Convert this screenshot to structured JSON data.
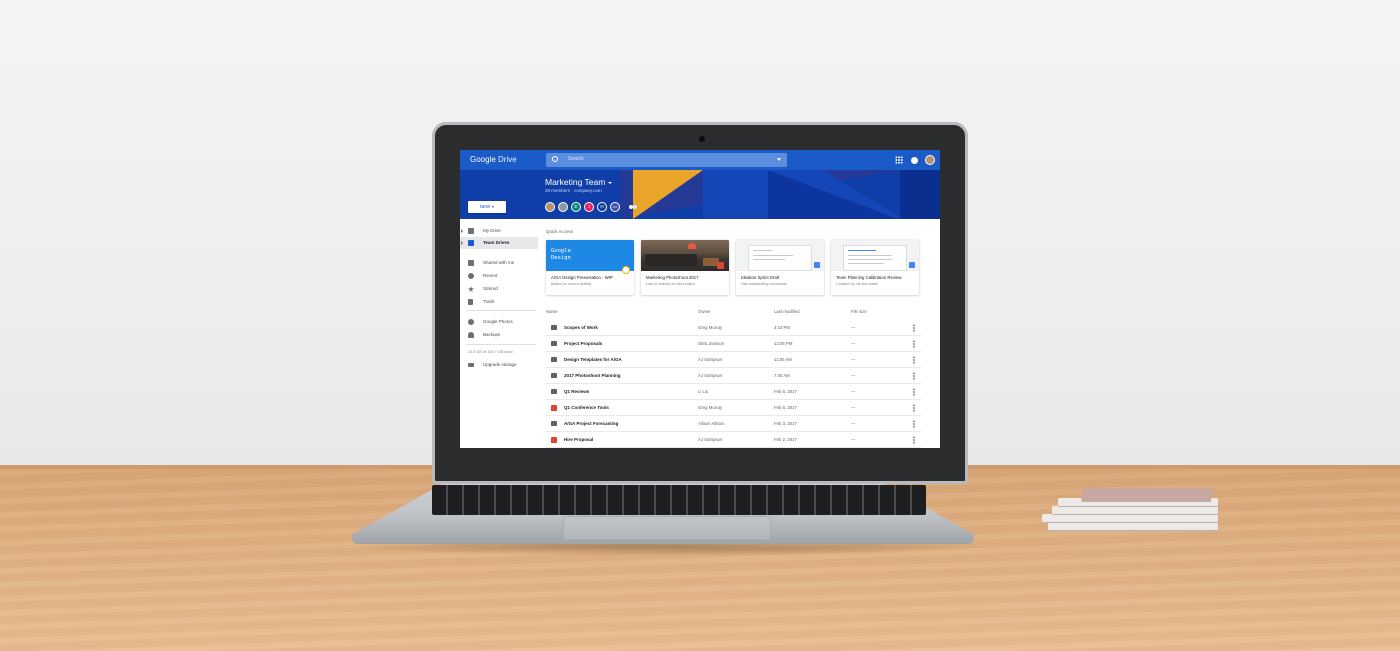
{
  "app": {
    "logo_prefix": "Google",
    "logo_name": "Drive"
  },
  "search": {
    "placeholder": "Search"
  },
  "team": {
    "title": "Marketing Team",
    "subtitle": "29 members · company.com"
  },
  "members": [
    {
      "initial": "",
      "color": "#b88e6b"
    },
    {
      "initial": "",
      "color": "#8a9aa6"
    },
    {
      "initial": "E",
      "color": "#00897b"
    },
    {
      "initial": "J",
      "color": "#e91e63"
    },
    {
      "initial": "H",
      "color": "#0f3ea8"
    },
    {
      "initial": "•••",
      "color": "#3f51b5"
    }
  ],
  "new_button": {
    "label": "NEW"
  },
  "sidebar": {
    "items": [
      {
        "label": "My Drive",
        "icon": "drive-icon"
      },
      {
        "label": "Team Drives",
        "icon": "team-drives-icon",
        "active": true
      },
      {
        "label": "Shared with me",
        "icon": "people-icon"
      },
      {
        "label": "Recent",
        "icon": "clock-icon"
      },
      {
        "label": "Starred",
        "icon": "star-icon"
      },
      {
        "label": "Trash",
        "icon": "trash-icon"
      },
      {
        "label": "Google Photos",
        "icon": "photos-icon"
      },
      {
        "label": "Backups",
        "icon": "cloud-icon"
      }
    ],
    "storage": "10.5 GB of 100.7 GB used",
    "upgrade": "Upgrade storage"
  },
  "quick_access": {
    "label": "Quick Access",
    "cards": [
      {
        "title": "A/GA Design Presentation - WIP",
        "subtitle": "Based on recent activity",
        "thumb_text": "Google Design"
      },
      {
        "title": "Marketing Photoshoot 2017",
        "subtitle": "Lots of activity on this project"
      },
      {
        "title": "Ideation Sprint Draft",
        "subtitle": "Has outstanding comments"
      },
      {
        "title": "Team Planning Calibration Review",
        "subtitle": "Created by me this week"
      }
    ]
  },
  "file_list": {
    "columns": [
      "Name",
      "Owner",
      "Last modified",
      "File size"
    ],
    "rows": [
      {
        "name": "Scopes of Work",
        "owner": "Greg Murray",
        "modified": "3:10 PM",
        "size": "—",
        "icon": "folder-icon"
      },
      {
        "name": "Project Proposals",
        "owner": "Oleb Jackson",
        "modified": "12:05 PM",
        "size": "—",
        "icon": "shared-folder-icon"
      },
      {
        "name": "Design Templates for A/GA",
        "owner": "AJ Sampson",
        "modified": "11:50 AM",
        "size": "—",
        "icon": "folder-icon"
      },
      {
        "name": "2017 Photoshoot Planning",
        "owner": "AJ Sampson",
        "modified": "7:40 AM",
        "size": "—",
        "icon": "shared-folder-icon"
      },
      {
        "name": "Q1 Reviews",
        "owner": "Li Liu",
        "modified": "Feb 6, 2017",
        "size": "—",
        "icon": "shared-folder-icon"
      },
      {
        "name": "Q1 Conference Tools",
        "owner": "Greg Murray",
        "modified": "Feb 6, 2017",
        "size": "—",
        "icon": "slides-icon"
      },
      {
        "name": "A/GA Project Forecasting",
        "owner": "Allison Allston",
        "modified": "Feb 3, 2017",
        "size": "—",
        "icon": "shared-folder-icon"
      },
      {
        "name": "Hire Proposal",
        "owner": "AJ Sampson",
        "modified": "Feb 2, 2017",
        "size": "—",
        "icon": "slides-icon"
      }
    ]
  },
  "colors": {
    "brand_blue": "#1a5bc7",
    "banner_blue": "#0f3ea8",
    "accent_yellow": "#e9a42a"
  }
}
